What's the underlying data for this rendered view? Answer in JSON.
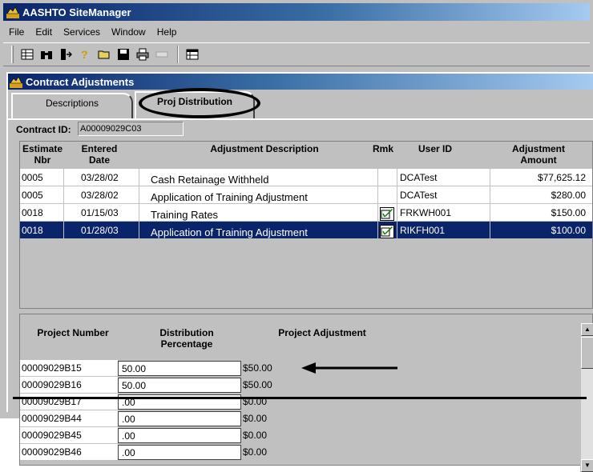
{
  "app": {
    "title": "AASHTO SiteManager"
  },
  "menu": {
    "items": [
      {
        "label": "File"
      },
      {
        "label": "Edit"
      },
      {
        "label": "Services"
      },
      {
        "label": "Window"
      },
      {
        "label": "Help"
      }
    ]
  },
  "toolbar": {
    "icons": [
      "grid-icon",
      "binoculars-icon",
      "exit-icon",
      "help-icon",
      "open-folder-icon",
      "save-icon",
      "print-icon",
      "fields-icon",
      "table-icon"
    ]
  },
  "window": {
    "title": "Contract Adjustments",
    "tabs": [
      {
        "label": "Descriptions"
      },
      {
        "label": "Proj Distribution"
      }
    ]
  },
  "contract": {
    "label": "Contract ID:",
    "value": "A00009029C03"
  },
  "adjustments": {
    "headers": {
      "estimate": "Estimate Nbr",
      "entered": "Entered Date",
      "description": "Adjustment Description",
      "rmk": "Rmk",
      "user": "User ID",
      "amount": "Adjustment Amount"
    },
    "rows": [
      {
        "estimate": "0005",
        "date": "03/28/02",
        "description": "Cash Retainage Withheld",
        "user": "DCATest",
        "amount": "$77,625.12"
      },
      {
        "estimate": "0005",
        "date": "03/28/02",
        "description": "Application of Training Adjustment",
        "user": "DCATest",
        "amount": "$280.00"
      },
      {
        "estimate": "0018",
        "date": "01/15/03",
        "description": "Training Rates",
        "user": "FRKWH001",
        "amount": "$150.00"
      },
      {
        "estimate": "0018",
        "date": "01/28/03",
        "description": "Application of Training Adjustment",
        "user": "RIKFH001",
        "amount": "$100.00"
      }
    ]
  },
  "distribution": {
    "headers": {
      "project": "Project Number",
      "percentage": "Distribution Percentage",
      "adjustment": "Project Adjustment"
    },
    "rows": [
      {
        "project": "00009029B15",
        "percentage": "50.00",
        "adjustment": "$50.00"
      },
      {
        "project": "00009029B16",
        "percentage": "50.00",
        "adjustment": "$50.00"
      },
      {
        "project": "00009029B17",
        "percentage": ".00",
        "adjustment": "$0.00"
      },
      {
        "project": "00009029B44",
        "percentage": ".00",
        "adjustment": "$0.00"
      },
      {
        "project": "00009029B45",
        "percentage": ".00",
        "adjustment": "$0.00"
      },
      {
        "project": "00009029B46",
        "percentage": ".00",
        "adjustment": "$0.00"
      }
    ]
  }
}
